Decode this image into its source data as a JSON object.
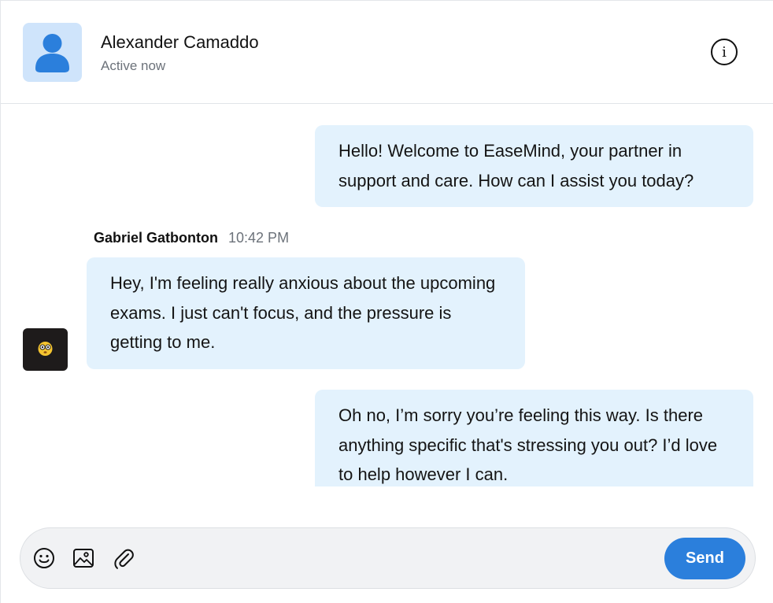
{
  "header": {
    "contact_name": "Alexander Camaddo",
    "status": "Active now",
    "info_icon": "info-icon",
    "info_glyph": "i"
  },
  "messages": [
    {
      "direction": "outgoing",
      "text": "Hello! Welcome to EaseMind, your partner in support and care. How can I assist you today?"
    },
    {
      "direction": "incoming",
      "sender": "Gabriel Gatbonton",
      "time": "10:42 PM",
      "text": "Hey, I'm feeling really anxious about the upcoming exams. I just can't focus, and the pressure is getting to me."
    },
    {
      "direction": "outgoing",
      "text": "Oh no, I’m sorry you’re feeling this way. Is there anything specific that's stressing you out? I’d love to help however I can."
    }
  ],
  "composer": {
    "icons": [
      "emoji-icon",
      "image-icon",
      "attachment-icon"
    ],
    "send_label": "Send"
  },
  "colors": {
    "bubble": "#e3f2fd",
    "accent": "#2b7fdc",
    "avatar_bg": "#cfe4fb",
    "composer_bg": "#f1f2f4"
  }
}
